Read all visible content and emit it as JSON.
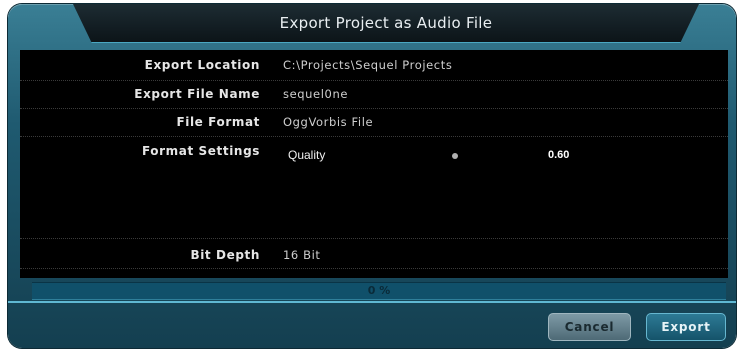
{
  "dialog": {
    "title": "Export Project as Audio File"
  },
  "fields": {
    "export_location": {
      "label": "Export Location",
      "value": "C:\\Projects\\Sequel Projects"
    },
    "export_file_name": {
      "label": "Export File Name",
      "value": "sequel0ne"
    },
    "file_format": {
      "label": "File Format",
      "value": "OggVorbis File"
    },
    "format_settings": {
      "label": "Format Settings",
      "quality_label": "Quality",
      "quality_value": "0.60"
    },
    "bit_depth": {
      "label": "Bit Depth",
      "value": "16 Bit"
    }
  },
  "progress": {
    "text": "0 %",
    "fraction": 0
  },
  "buttons": {
    "cancel": "Cancel",
    "export": "Export"
  },
  "colors": {
    "accent": "#1f5a70",
    "background": "#000000"
  }
}
